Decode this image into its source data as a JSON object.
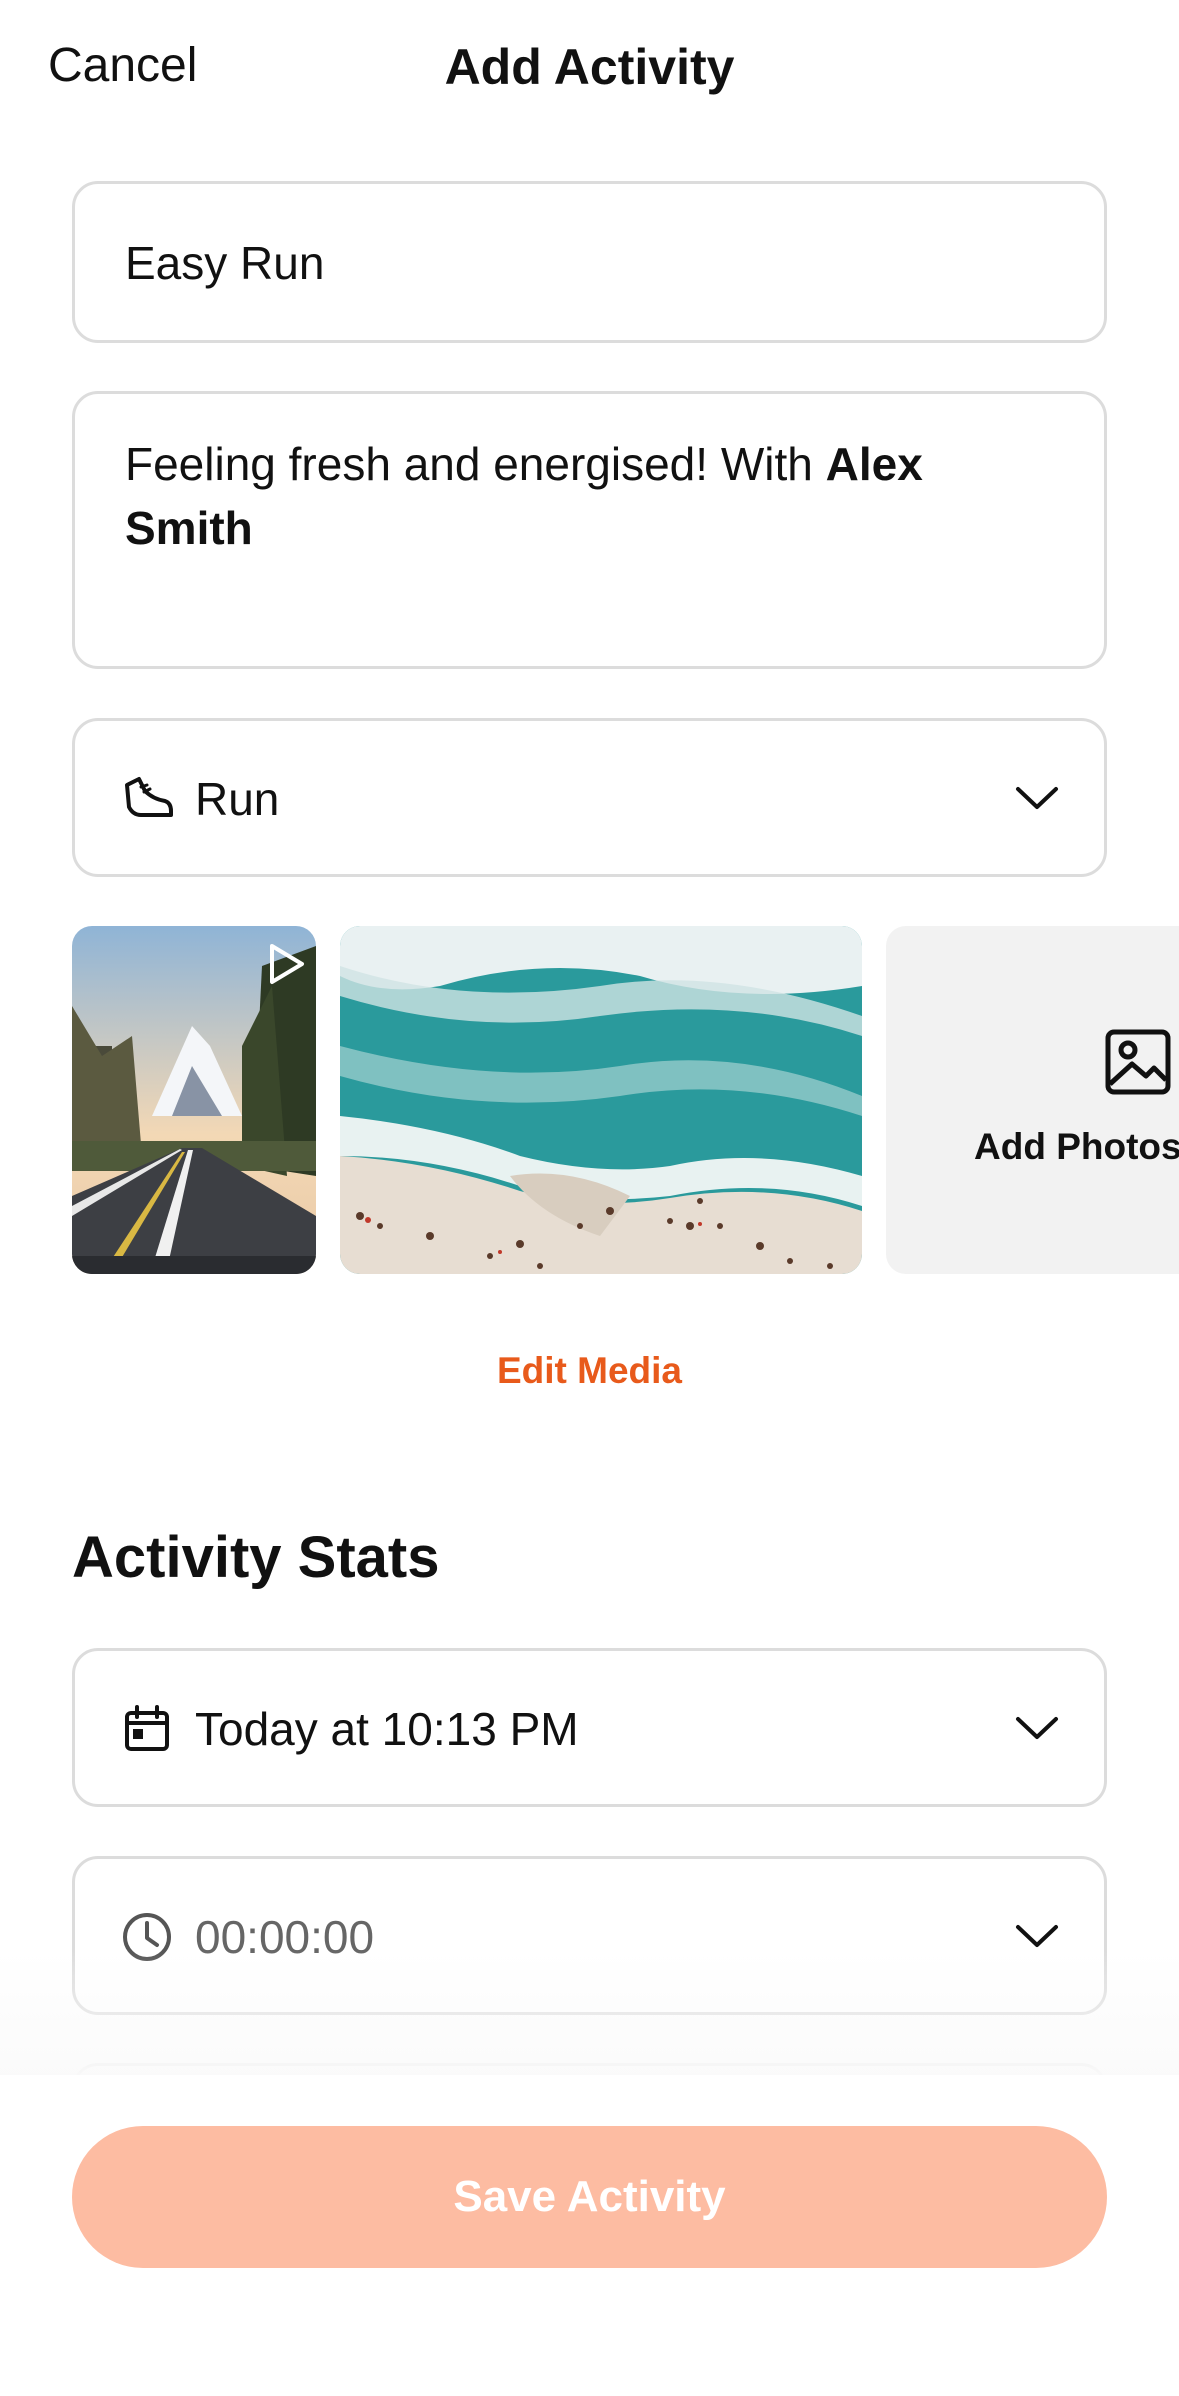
{
  "header": {
    "cancel_label": "Cancel",
    "title": "Add Activity"
  },
  "form": {
    "name_value": "Easy Run",
    "description": {
      "text": "Feeling fresh and energised! With ",
      "mention": "Alex Smith"
    },
    "sport": {
      "icon": "shoe-icon",
      "value": "Run"
    }
  },
  "media": {
    "items": [
      {
        "type": "video",
        "subject": "mountain road"
      },
      {
        "type": "photo",
        "subject": "aerial beach with waves"
      }
    ],
    "add_label": "Add Photos",
    "edit_label": "Edit Media"
  },
  "stats": {
    "section_title": "Activity Stats",
    "date": {
      "icon": "calendar-icon",
      "value": "Today at 10:13 PM"
    },
    "time": {
      "icon": "clock-icon",
      "value": "00:00:00"
    }
  },
  "footer": {
    "save_label": "Save Activity",
    "save_color": "#fdbca2"
  },
  "colors": {
    "accent": "#e85a1b"
  }
}
